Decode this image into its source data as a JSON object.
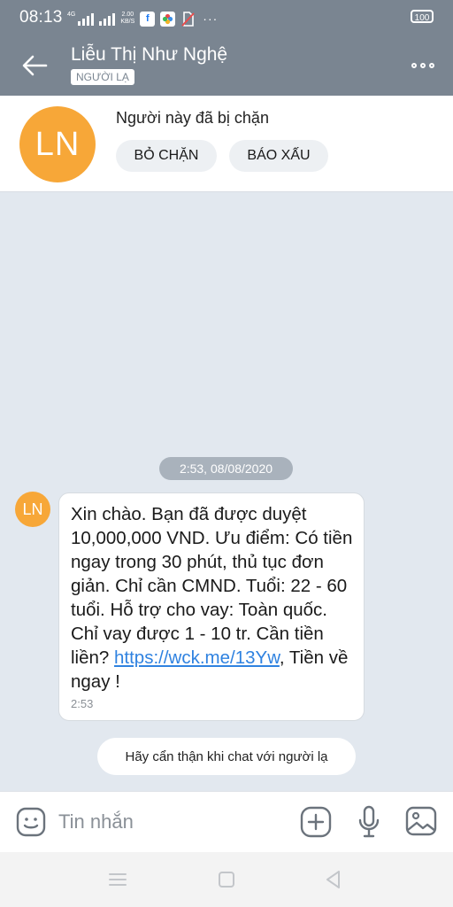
{
  "status_bar": {
    "time": "08:13",
    "network": "4G",
    "speed_value": "2.00",
    "speed_unit": "KB/S",
    "battery": "100",
    "more": "···",
    "app_icons": [
      "facebook-icon",
      "photos-app-icon",
      "no-sim-icon"
    ]
  },
  "header": {
    "contact_name": "Liễu Thị Như Nghệ",
    "badge": "NGƯỜI LẠ"
  },
  "blocked_panel": {
    "avatar_initials": "LN",
    "message": "Người này đã bị chặn",
    "unblock_label": "BỎ CHẶN",
    "report_label": "BÁO XẤU"
  },
  "conversation": {
    "date_separator": "2:53, 08/08/2020",
    "messages": [
      {
        "sender_initials": "LN",
        "text_before_link": "Xin chào. Bạn đã được duyệt 10,000,000 VND. Ưu điểm: Có tiền ngay trong 30 phút, thủ tục đơn giản. Chỉ cần CMND. Tuổi: 22 - 60 tuổi. Hỗ trợ cho vay: Toàn quốc. Chỉ vay được 1 - 10 tr. Cần tiền liền? ",
        "link": "https://wck.me/13Yw",
        "text_after_link": ", Tiền về ngay !",
        "time": "2:53"
      }
    ],
    "stranger_warning": "Hãy cẩn thận khi chat với người lạ"
  },
  "composer": {
    "placeholder": "Tin nhắn"
  },
  "colors": {
    "header_bg": "#7a8591",
    "avatar": "#f7a738",
    "link": "#2f82e0",
    "chat_bg": "#e2e8ef"
  }
}
